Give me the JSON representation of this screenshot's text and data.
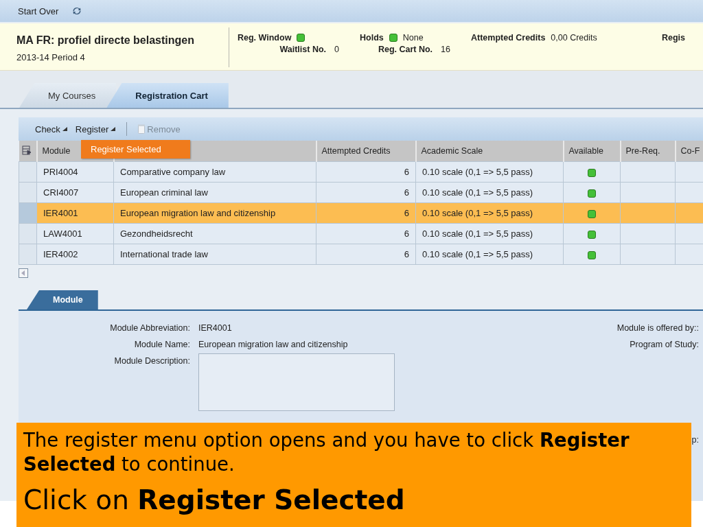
{
  "top_bar": {
    "start_over": "Start Over"
  },
  "header": {
    "title": "MA FR: profiel directe belastingen",
    "period": "2013-14 Period 4",
    "stats": [
      {
        "kind": "indicator",
        "label": "Reg. Window"
      },
      {
        "kind": "indicator",
        "label": "Holds",
        "value": "None"
      },
      {
        "kind": "text",
        "label": "Attempted Credits",
        "value": "0,00 Credits"
      },
      {
        "kind": "text",
        "label": "Regis"
      }
    ],
    "stats_row2": [
      {
        "label": "Waitlist No.",
        "value": "0"
      },
      {
        "label": "Reg. Cart No.",
        "value": "16"
      }
    ]
  },
  "tabs": [
    {
      "label": "My Courses",
      "selected": false
    },
    {
      "label": "Registration Cart",
      "selected": true
    }
  ],
  "table_toolbar": [
    {
      "kind": "menu",
      "label": "Check",
      "disabled": false
    },
    {
      "kind": "menu",
      "label": "Register",
      "disabled": false,
      "menu": [
        "Register Selected"
      ]
    },
    {
      "kind": "action",
      "label": "Remove",
      "disabled": true
    }
  ],
  "table": {
    "columns": [
      {
        "label": "Module"
      },
      {},
      {
        "label": "Attempted Credits"
      },
      {
        "label": "Academic Scale"
      },
      {
        "label": "Available"
      },
      {
        "label": "Pre-Req."
      },
      {
        "label": "Co-F"
      }
    ],
    "rows": [
      {
        "module": "PRI4004",
        "name": "Comparative company law",
        "credits": "6",
        "scale": "0.10 scale (0,1 => 5,5 pass)",
        "available": true,
        "selected": false
      },
      {
        "module": "CRI4007",
        "name": "European criminal law",
        "credits": "6",
        "scale": "0.10 scale (0,1 => 5,5 pass)",
        "available": true,
        "selected": false
      },
      {
        "module": "IER4001",
        "name": "European migration law and citizenship",
        "credits": "6",
        "scale": "0.10 scale (0,1 => 5,5 pass)",
        "available": true,
        "selected": true
      },
      {
        "module": "LAW4001",
        "name": "Gezondheidsrecht",
        "credits": "6",
        "scale": "0.10 scale (0,1 => 5,5 pass)",
        "available": true,
        "selected": false
      },
      {
        "module": "IER4002",
        "name": "International trade law",
        "credits": "6",
        "scale": "0.10 scale (0,1 => 5,5 pass)",
        "available": true,
        "selected": false
      }
    ]
  },
  "detail": {
    "tab": {
      "label": "Module",
      "selected": true
    },
    "fields": [
      {
        "kind": "text",
        "label": "Module Abbreviation:",
        "value": "IER4001"
      },
      {
        "kind": "text",
        "label": "Module Name:",
        "value": "European migration law and citizenship"
      },
      {
        "kind": "textarea",
        "label": "Module Description:"
      }
    ],
    "right_fields": [
      {
        "label": "Module is offered by::"
      },
      {
        "label": "Program of Study:"
      }
    ],
    "cut_label": "p:"
  },
  "callout": {
    "text": "The register menu option opens and you have to click **Register Selected** to continue.",
    "headline": "Click on **Register Selected**"
  }
}
